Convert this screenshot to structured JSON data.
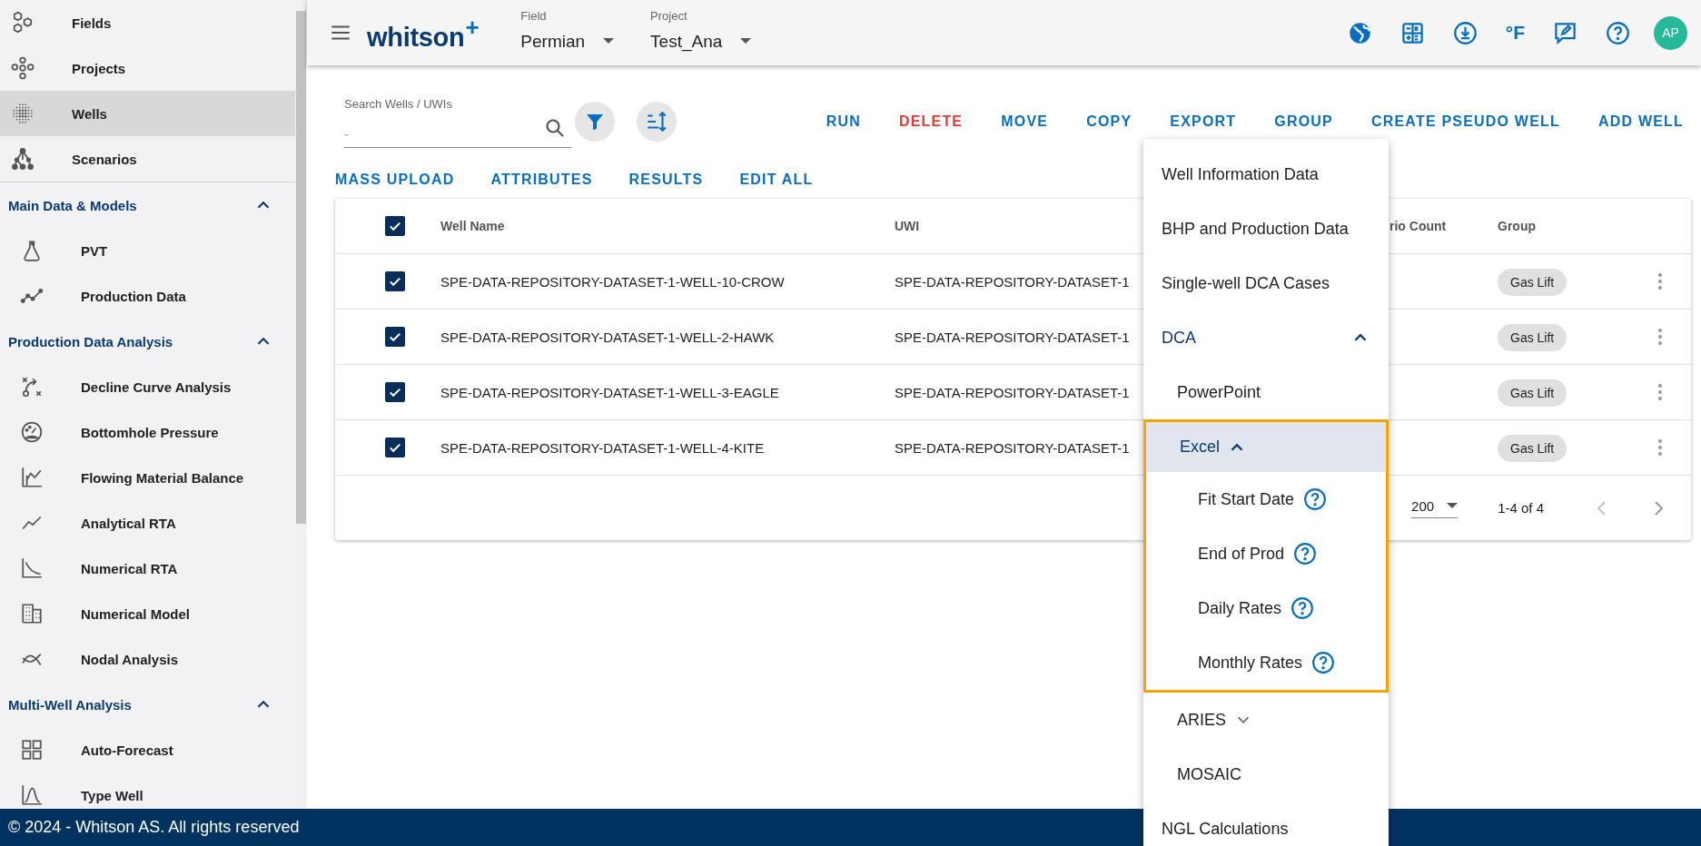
{
  "top_bar": {
    "logo": "whitson$^{+}$",
    "field": {
      "label": "Field",
      "value": "Permian"
    },
    "project": {
      "label": "Project",
      "value": "Test_Ana"
    },
    "units": "°F",
    "avatar": "AP"
  },
  "sidebar": {
    "nav": [
      {
        "label": "Fields",
        "selected": false
      },
      {
        "label": "Projects",
        "selected": false
      },
      {
        "label": "Wells",
        "selected": true
      },
      {
        "label": "Scenarios",
        "selected": false
      }
    ],
    "sections": [
      {
        "title": "Main Data & Models",
        "expanded": true,
        "items": [
          {
            "label": "PVT",
            "selected": false
          },
          {
            "label": "Production Data",
            "selected": false
          }
        ]
      },
      {
        "title": "Production Data Analysis",
        "expanded": true,
        "items": [
          {
            "label": "Decline Curve Analysis",
            "selected": false
          },
          {
            "label": "Bottomhole Pressure",
            "selected": false
          },
          {
            "label": "Flowing Material Balance",
            "selected": false
          },
          {
            "label": "Analytical RTA",
            "selected": false
          },
          {
            "label": "Numerical RTA",
            "selected": false
          },
          {
            "label": "Numerical Model",
            "selected": false
          },
          {
            "label": "Nodal Analysis",
            "selected": false
          }
        ]
      },
      {
        "title": "Multi-Well Analysis",
        "expanded": true,
        "items": [
          {
            "label": "Auto-Forecast",
            "selected": false
          },
          {
            "label": "Type Well",
            "selected": false
          }
        ]
      }
    ]
  },
  "search": {
    "label": "Search Wells / UWIs",
    "placeholder": "-"
  },
  "actions": [
    {
      "label": "RUN",
      "kind": "primary"
    },
    {
      "label": "DELETE",
      "kind": "danger"
    },
    {
      "label": "MOVE",
      "kind": "primary"
    },
    {
      "label": "COPY",
      "kind": "primary"
    },
    {
      "label": "EXPORT",
      "kind": "primary"
    },
    {
      "label": "GROUP",
      "kind": "primary"
    },
    {
      "label": "CREATE PSEUDO WELL",
      "kind": "primary"
    },
    {
      "label": "ADD WELL",
      "kind": "primary"
    }
  ],
  "secondary_actions": [
    "MASS UPLOAD",
    "ATTRIBUTES",
    "RESULTS",
    "EDIT ALL"
  ],
  "table": {
    "all_checked": true,
    "columns": [
      "Well Name",
      "UWI",
      "rio Count",
      "Group"
    ],
    "rows": [
      {
        "checked": true,
        "well_name": "SPE-DATA-REPOSITORY-DATASET-1-WELL-10-CROW",
        "uwi": "SPE-DATA-REPOSITORY-DATASET-1",
        "group": "Gas Lift"
      },
      {
        "checked": true,
        "well_name": "SPE-DATA-REPOSITORY-DATASET-1-WELL-2-HAWK",
        "uwi": "SPE-DATA-REPOSITORY-DATASET-1",
        "group": "Gas Lift"
      },
      {
        "checked": true,
        "well_name": "SPE-DATA-REPOSITORY-DATASET-1-WELL-3-EAGLE",
        "uwi": "SPE-DATA-REPOSITORY-DATASET-1",
        "group": "Gas Lift"
      },
      {
        "checked": true,
        "well_name": "SPE-DATA-REPOSITORY-DATASET-1-WELL-4-KITE",
        "uwi": "SPE-DATA-REPOSITORY-DATASET-1",
        "group": "Gas Lift"
      }
    ],
    "pagination": {
      "rows_per_page": "200",
      "range": "1-4 of 4"
    }
  },
  "export_menu": {
    "items": [
      {
        "label": "Well Information Data",
        "selected": false
      },
      {
        "label": "BHP and Production Data",
        "selected": false
      },
      {
        "label": "Single-well DCA Cases",
        "selected": false
      },
      {
        "label": "DCA",
        "selected": false,
        "expanded": true,
        "children": [
          {
            "label": "PowerPoint",
            "selected": false
          },
          {
            "label": "Excel",
            "selected": true,
            "expanded": true,
            "children": [
              {
                "label": "Fit Start Date",
                "selected": false
              },
              {
                "label": "End of Prod",
                "selected": false
              },
              {
                "label": "Daily Rates",
                "selected": false
              },
              {
                "label": "Monthly Rates",
                "selected": false
              }
            ]
          },
          {
            "label": "ARIES",
            "selected": false,
            "expanded": false
          },
          {
            "label": "MOSAIC",
            "selected": false
          }
        ]
      },
      {
        "label": "NGL Calculations",
        "selected": false
      }
    ]
  },
  "footer": "© 2024 - Whitson AS. All rights reserved"
}
